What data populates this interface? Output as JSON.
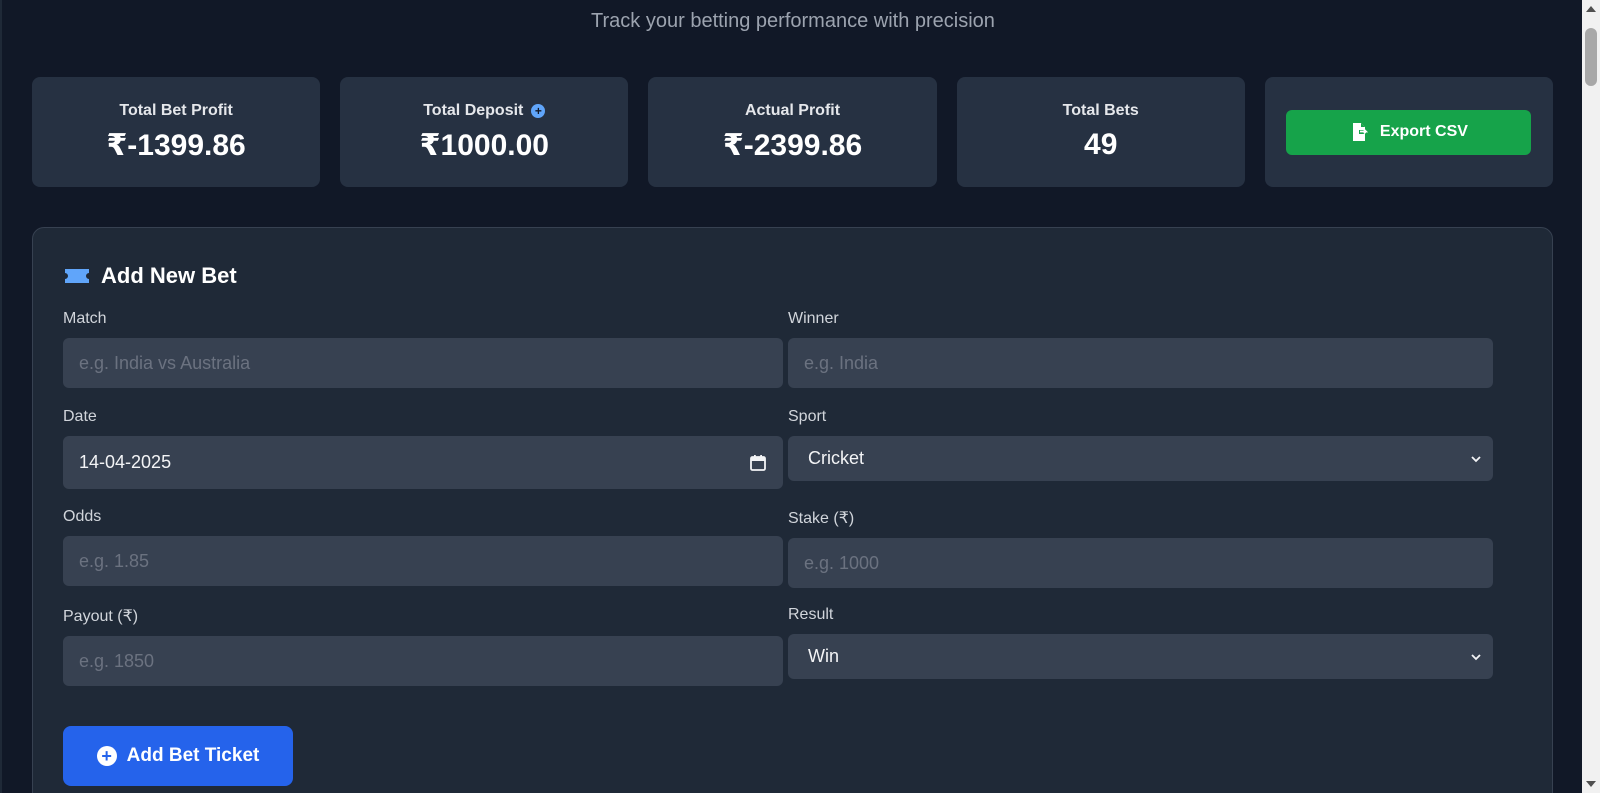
{
  "header": {
    "subtitle": "Track your betting performance with precision"
  },
  "stats": [
    {
      "label": "Total Bet Profit",
      "value": "₹-1399.86"
    },
    {
      "label": "Total Deposit",
      "value": "₹1000.00"
    },
    {
      "label": "Actual Profit",
      "value": "₹-2399.86"
    },
    {
      "label": "Total Bets",
      "value": "49"
    }
  ],
  "export": {
    "label": "Export CSV"
  },
  "form": {
    "title": "Add New Bet",
    "match": {
      "label": "Match",
      "placeholder": "e.g. India vs Australia"
    },
    "winner": {
      "label": "Winner",
      "placeholder": "e.g. India"
    },
    "date": {
      "label": "Date",
      "value": "14-04-2025"
    },
    "sport": {
      "label": "Sport",
      "value": "Cricket"
    },
    "odds": {
      "label": "Odds",
      "placeholder": "e.g. 1.85"
    },
    "stake": {
      "label": "Stake (₹)",
      "placeholder": "e.g. 1000"
    },
    "payout": {
      "label": "Payout (₹)",
      "placeholder": "e.g. 1850"
    },
    "result": {
      "label": "Result",
      "value": "Win"
    },
    "submit_label": "Add Bet Ticket"
  },
  "colors": {
    "background": "#111827",
    "card": "#263142",
    "panel": "#1f2937",
    "input": "#374151",
    "export_green": "#16a34a",
    "primary_blue": "#2563eb",
    "icon_blue": "#60a5fa"
  },
  "icons": {
    "deposit_info": "plus-circle-icon",
    "export": "file-export-icon",
    "form_title": "ticket-icon",
    "date": "calendar-icon",
    "select": "chevron-down-icon",
    "submit": "plus-circle-icon"
  }
}
